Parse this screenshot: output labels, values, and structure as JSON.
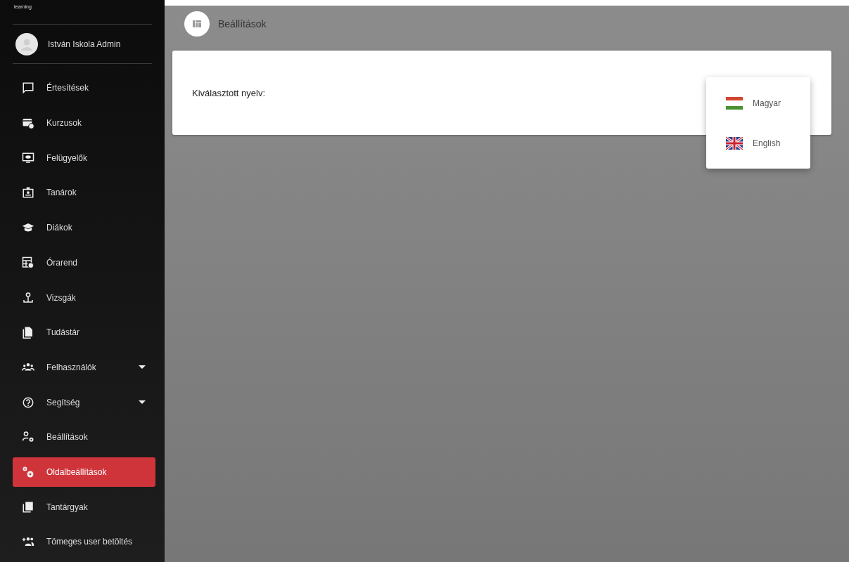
{
  "sidebar": {
    "logo_text": "learning",
    "user": {
      "name": "István Iskola Admin"
    },
    "items": [
      {
        "label": "Értesítések",
        "kind": "link",
        "selected": false
      },
      {
        "label": "Kurzusok",
        "kind": "link",
        "selected": false
      },
      {
        "label": "Felügyelők",
        "kind": "link",
        "selected": false
      },
      {
        "label": "Tanárok",
        "kind": "link",
        "selected": false
      },
      {
        "label": "Diákok",
        "kind": "link",
        "selected": false
      },
      {
        "label": "Órarend",
        "kind": "link",
        "selected": false
      },
      {
        "label": "Vizsgák",
        "kind": "link",
        "selected": false
      },
      {
        "label": "Tudástár",
        "kind": "link",
        "selected": false
      },
      {
        "label": "Felhasználók",
        "kind": "group",
        "selected": false
      },
      {
        "label": "Segítség",
        "kind": "group",
        "selected": false
      },
      {
        "label": "Beállítások",
        "kind": "link",
        "selected": false
      },
      {
        "label": "Oldalbeállítások",
        "kind": "link",
        "selected": true
      },
      {
        "label": "Tantárgyak",
        "kind": "link",
        "selected": false
      },
      {
        "label": "Tömeges user betöltés",
        "kind": "link",
        "selected": false
      }
    ]
  },
  "page": {
    "title": "Beállítások",
    "field_label": "Kiválasztott nyelv:"
  },
  "language_menu": [
    {
      "label": "Magyar"
    },
    {
      "label": "English"
    }
  ]
}
